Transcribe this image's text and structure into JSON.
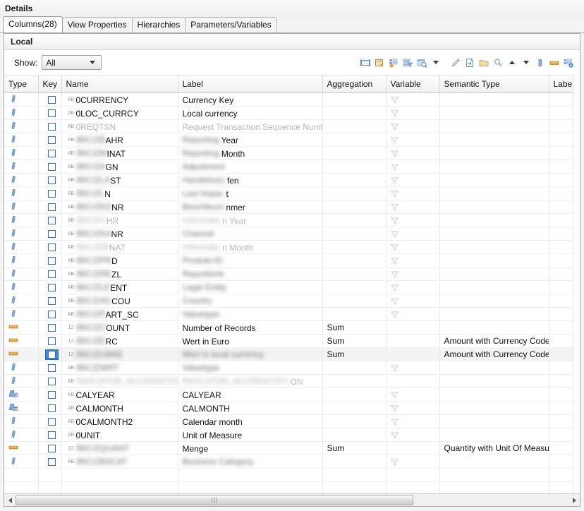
{
  "window": {
    "title": "Details"
  },
  "tabs": [
    {
      "label": "Columns(28)",
      "active": true
    },
    {
      "label": "View Properties",
      "active": false
    },
    {
      "label": "Hierarchies",
      "active": false
    },
    {
      "label": "Parameters/Variables",
      "active": false
    }
  ],
  "panel": {
    "title": "Local"
  },
  "toolbar": {
    "show_label": "Show:",
    "show_value": "All",
    "icons": [
      "layout-columns-icon",
      "note-icon",
      "column-properties-icon",
      "filter-columns-icon",
      "search-columns-icon",
      "dropdown-caret-icon",
      "edit-pencil-icon",
      "import-icon",
      "folder-icon",
      "find-icon",
      "move-up-icon",
      "move-down-icon",
      "mask-icon",
      "measure-icon",
      "add-column-icon"
    ]
  },
  "table": {
    "columns": [
      {
        "key": "type",
        "label": "Type"
      },
      {
        "key": "keycol",
        "label": "Key"
      },
      {
        "key": "name",
        "label": "Name"
      },
      {
        "key": "label",
        "label": "Label"
      },
      {
        "key": "agg",
        "label": "Aggregation"
      },
      {
        "key": "variable",
        "label": "Variable"
      },
      {
        "key": "semantic",
        "label": "Semantic Type"
      },
      {
        "key": "labelcol",
        "label": "Label C"
      }
    ],
    "rows": [
      {
        "type": "attribute",
        "dtype": "AB",
        "name": "0CURRENCY",
        "name_blur": false,
        "label": "Currency Key",
        "label_blur": false,
        "agg": "",
        "variable": "funnel",
        "semantic": "",
        "selected": false
      },
      {
        "type": "attribute",
        "dtype": "AB",
        "name": "0LOC_CURRCY",
        "name_blur": false,
        "label": "Local currency",
        "label_blur": false,
        "agg": "",
        "variable": "funnel",
        "semantic": "",
        "selected": false
      },
      {
        "type": "attribute",
        "dtype": "AB",
        "name": "0REQTSN",
        "name_blur": false,
        "name_dim": true,
        "label": "Request Transaction Sequence Number",
        "label_blur": false,
        "label_dim": true,
        "agg": "",
        "variable": "funnel",
        "semantic": "",
        "selected": false
      },
      {
        "type": "attribute",
        "dtype": "AB",
        "name_prefix_blur": "/BIC/ZB",
        "name": "AHR",
        "name_blur": false,
        "label_prefix_blur": "Reporting",
        "label": "Year",
        "label_blur": false,
        "agg": "",
        "variable": "funnel",
        "semantic": "",
        "selected": false
      },
      {
        "type": "attribute",
        "dtype": "AB",
        "name_prefix_blur": "/BIC/ZM",
        "name": "INAT",
        "name_blur": false,
        "label_prefix_blur": "Reporting",
        "label": "Month",
        "label_blur": false,
        "agg": "",
        "variable": "funnel",
        "semantic": "",
        "selected": false
      },
      {
        "type": "attribute",
        "dtype": "AB",
        "name_prefix_blur": "/BIC/ZA",
        "name": "GN",
        "name_blur": false,
        "label_prefix_blur": "Adjustment",
        "label": "",
        "label_blur": false,
        "agg": "",
        "variable": "funnel",
        "semantic": "",
        "selected": false
      },
      {
        "type": "attribute",
        "dtype": "AB",
        "name_prefix_blur": "/BIC/ZLA",
        "name": "ST",
        "name_blur": false,
        "label_prefix_blur": "Handelsstu",
        "label": "fen",
        "label_blur": false,
        "agg": "",
        "variable": "funnel",
        "semantic": "",
        "selected": false
      },
      {
        "type": "attribute",
        "dtype": "AB",
        "name_prefix_blur": "/BIC/ZL",
        "name": "N",
        "name_blur": false,
        "label_prefix_blur": "Last Impac",
        "label": "t",
        "label_blur": false,
        "agg": "",
        "variable": "funnel",
        "semantic": "",
        "selected": false
      },
      {
        "type": "attribute",
        "dtype": "AB",
        "name_prefix_blur": "/BIC/ZKD",
        "name": "NR",
        "name_blur": false,
        "label_prefix_blur": "Beschleuni",
        "label": "nmer",
        "label_blur": false,
        "agg": "",
        "variable": "funnel",
        "semantic": "",
        "selected": false
      },
      {
        "type": "attribute",
        "dtype": "AB",
        "name_prefix_blur": "/BIC/ZIJ",
        "name": "HR",
        "name_blur": false,
        "name_dim": true,
        "label_prefix_blur": "Informatio",
        "label": "n Year",
        "label_blur": false,
        "label_dim": true,
        "agg": "",
        "variable": "funnel",
        "semantic": "",
        "selected": false
      },
      {
        "type": "attribute",
        "dtype": "AB",
        "name_prefix_blur": "/BIC/ZKA",
        "name": "NR",
        "name_blur": false,
        "label_prefix_blur": "Channel",
        "label": "",
        "label_blur": false,
        "agg": "",
        "variable": "funnel",
        "semantic": "",
        "selected": false
      },
      {
        "type": "attribute",
        "dtype": "AB",
        "name_prefix_blur": "/BIC/ZIM",
        "name": "NAT",
        "name_blur": false,
        "name_dim": true,
        "label_prefix_blur": "Informatio",
        "label": "n Month",
        "label_blur": false,
        "label_dim": true,
        "agg": "",
        "variable": "funnel",
        "semantic": "",
        "selected": false
      },
      {
        "type": "attribute",
        "dtype": "AB",
        "name_prefix_blur": "/BIC/ZPR",
        "name": "D",
        "name_blur": false,
        "label_prefix_blur": "Produkt-ID",
        "label": "",
        "label_blur": false,
        "agg": "",
        "variable": "funnel",
        "semantic": "",
        "selected": false
      },
      {
        "type": "attribute",
        "dtype": "AB",
        "name_prefix_blur": "/BIC/ZRE",
        "name": "ZL",
        "name_blur": false,
        "label_prefix_blur": "Reportierte",
        "label": "",
        "label_blur": false,
        "agg": "",
        "variable": "funnel",
        "semantic": "",
        "selected": false
      },
      {
        "type": "attribute",
        "dtype": "AB",
        "name_prefix_blur": "/BIC/ZLE",
        "name": "ENT",
        "name_blur": false,
        "label_prefix_blur": "Legal Entity",
        "label": "",
        "label_blur": false,
        "agg": "",
        "variable": "funnel",
        "semantic": "",
        "selected": false
      },
      {
        "type": "attribute",
        "dtype": "AB",
        "name_prefix_blur": "/BIC/ZAC",
        "name": "COU",
        "name_blur": false,
        "label_prefix_blur": "Country",
        "label": "",
        "label_blur": false,
        "agg": "",
        "variable": "funnel",
        "semantic": "",
        "selected": false
      },
      {
        "type": "attribute",
        "dtype": "AB",
        "name_prefix_blur": "/BIC/ZP",
        "name": "ART_SC",
        "name_blur": false,
        "label_prefix_blur": "Valuetype",
        "label": "",
        "label_blur": false,
        "agg": "",
        "variable": "funnel",
        "semantic": "",
        "selected": false
      },
      {
        "type": "measure",
        "dtype": "12",
        "name_prefix_blur": "/BIC/ZC",
        "name": "OUNT",
        "name_blur": false,
        "label": "Number of Records",
        "label_blur": false,
        "agg": "Sum",
        "variable": "",
        "semantic": "",
        "selected": false
      },
      {
        "type": "measure",
        "dtype": "12",
        "name_prefix_blur": "/BIC/ZE",
        "name": "RC",
        "name_blur": false,
        "label": "Wert in Euro",
        "label_blur": false,
        "agg": "Sum",
        "variable": "",
        "semantic": "Amount with Currency Code",
        "selected": false
      },
      {
        "type": "measure",
        "dtype": "12",
        "name_prefix_blur": "/BIC/ZLWAE",
        "name": "",
        "name_blur": false,
        "label_prefix_blur": "Wert in local currency",
        "label": "",
        "label_blur": false,
        "agg": "Sum",
        "variable": "",
        "semantic": "Amount with Currency Code",
        "selected": true
      },
      {
        "type": "attribute",
        "dtype": "AB",
        "name_prefix_blur": "/BIC/ZWRT",
        "name": "",
        "name_blur": false,
        "label_prefix_blur": "Valuetype",
        "label": "",
        "label_blur": false,
        "agg": "",
        "variable": "funnel",
        "semantic": "",
        "selected": false
      },
      {
        "type": "attribute",
        "dtype": "AB",
        "name_prefix_blur": "INDICATOR_ACCREDITATION",
        "name": "",
        "name_dim": true,
        "label_prefix_blur": "INDICATOR_ACCREDITATI",
        "label": "ON",
        "label_dim": true,
        "agg": "",
        "variable": "",
        "semantic": "",
        "selected": false
      },
      {
        "type": "calculated",
        "dtype": "AB",
        "name": "CALYEAR",
        "name_blur": false,
        "label": "CALYEAR",
        "label_blur": false,
        "agg": "",
        "variable": "funnel",
        "semantic": "",
        "selected": false
      },
      {
        "type": "calculated",
        "dtype": "AB",
        "name": "CALMONTH",
        "name_blur": false,
        "label": "CALMONTH",
        "label_blur": false,
        "agg": "",
        "variable": "funnel",
        "semantic": "",
        "selected": false
      },
      {
        "type": "attribute",
        "dtype": "AB",
        "name": "0CALMONTH2",
        "name_blur": false,
        "label": "Calendar month",
        "label_blur": false,
        "agg": "",
        "variable": "funnel",
        "semantic": "",
        "selected": false
      },
      {
        "type": "attribute",
        "dtype": "AB",
        "name": "0UNIT",
        "name_blur": false,
        "label": "Unit of Measure",
        "label_blur": false,
        "agg": "",
        "variable": "funnel",
        "semantic": "",
        "selected": false
      },
      {
        "type": "measure",
        "dtype": "12",
        "name_prefix_blur": "/BIC/ZQUANT",
        "name": "",
        "name_blur": false,
        "label": "Menge",
        "label_blur": false,
        "agg": "Sum",
        "variable": "",
        "semantic": "Quantity with Unit Of Measure",
        "selected": false
      },
      {
        "type": "attribute",
        "dtype": "AB",
        "name_prefix_blur": "/BIC/ZBSCAT",
        "name": "",
        "name_blur": false,
        "label_prefix_blur": "Business Category",
        "label": "",
        "label_blur": false,
        "agg": "",
        "variable": "funnel",
        "semantic": "",
        "selected": false
      }
    ],
    "empty_rows": 3
  },
  "scrollbar": {
    "left_arrow": "scroll-left-arrow",
    "right_arrow": "scroll-right-arrow",
    "grip": "|||"
  },
  "colors": {
    "attribute_icon": "#7ea7dc",
    "measure_icon": "#e8a33d",
    "selection": "#3d87d6",
    "header_bg": "#f0f0f0"
  }
}
